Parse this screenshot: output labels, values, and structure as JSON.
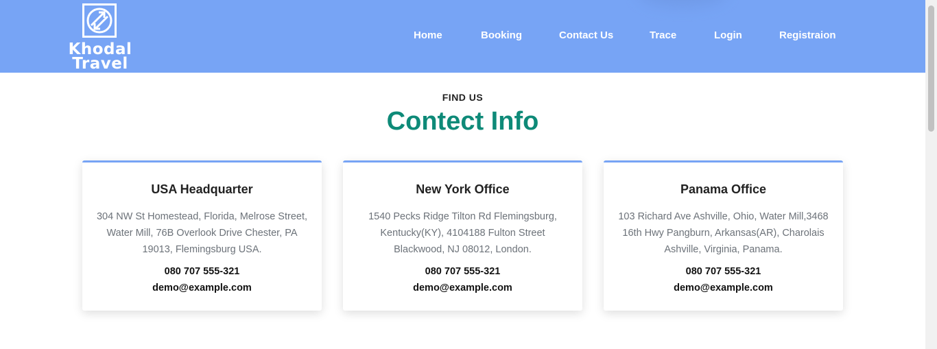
{
  "brand": {
    "line1": "Khodal",
    "line2": "Travel",
    "logo_icon": "globe-arrows-icon"
  },
  "nav": [
    {
      "label": "Home"
    },
    {
      "label": "Booking"
    },
    {
      "label": "Contact Us"
    },
    {
      "label": "Trace"
    },
    {
      "label": "Login"
    },
    {
      "label": "Registraion"
    }
  ],
  "section": {
    "eyebrow": "FIND US",
    "title": "Contect Info"
  },
  "cards": [
    {
      "title": "USA Headquarter",
      "address": "304 NW St Homestead, Florida, Melrose Street, Water Mill, 76B Overlook Drive Chester, PA 19013, Flemingsburg USA.",
      "phone": "080 707 555-321",
      "email": "demo@example.com"
    },
    {
      "title": "New York Office",
      "address": "1540 Pecks Ridge Tilton Rd Flemingsburg, Kentucky(KY), 4104188 Fulton Street Blackwood, NJ 08012, London.",
      "phone": "080 707 555-321",
      "email": "demo@example.com"
    },
    {
      "title": "Panama Office",
      "address": "103 Richard Ave Ashville, Ohio, Water Mill,3468 16th Hwy Pangburn, Arkansas(AR), Charolais Ashville, Virginia, Panama.",
      "phone": "080 707 555-321",
      "email": "demo@example.com"
    }
  ],
  "colors": {
    "header": "#77a4f5",
    "title": "#0e8a78",
    "card_accent": "#77a4f5"
  }
}
